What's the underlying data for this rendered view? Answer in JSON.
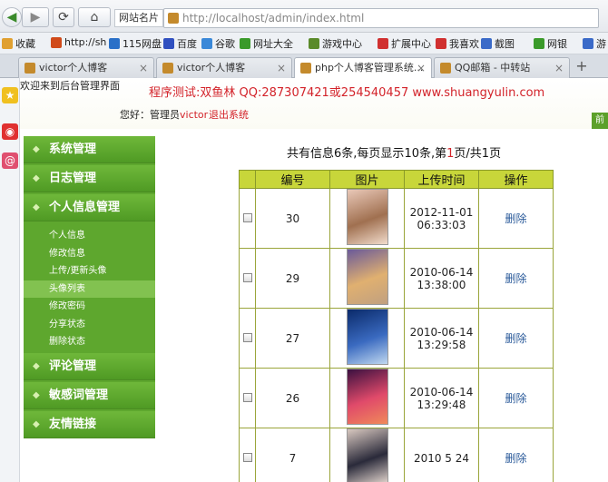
{
  "browser": {
    "site_name_label": "网站名片",
    "url": "http://localhost/admin/index.html",
    "bookmarks": [
      {
        "label": "收藏",
        "color": "#e0a030"
      },
      {
        "label": "http://sh",
        "color": "#d04a1a"
      },
      {
        "label": "115网盘",
        "color": "#2a70c8"
      },
      {
        "label": "百度",
        "color": "#3050c0"
      },
      {
        "label": "谷歌",
        "color": "#3a88d8"
      },
      {
        "label": "网址大全",
        "color": "#3a9a2a"
      },
      {
        "label": "游戏中心",
        "color": "#5a8a2a"
      },
      {
        "label": "扩展中心",
        "color": "#d03030"
      },
      {
        "label": "我喜欢",
        "color": "#d03030"
      },
      {
        "label": "截图",
        "color": "#3a6ac8"
      },
      {
        "label": "网银",
        "color": "#3a9a2a"
      },
      {
        "label": "游",
        "color": "#3a6ac8"
      }
    ],
    "tabs": [
      {
        "label": "victor个人博客",
        "active": false
      },
      {
        "label": "victor个人博客",
        "active": false
      },
      {
        "label": "php个人博客管理系统...",
        "active": true
      },
      {
        "label": "QQ邮箱 - 中转站",
        "active": false
      }
    ],
    "close_glyph": "×",
    "plus_glyph": "+"
  },
  "header": {
    "welcome": "欢迎来到后台管理界面",
    "promo": "程序测试:双鱼林 QQ:287307421或254540457 www.shuangyulin.com",
    "greet_prefix": "您好：管理员",
    "username": "victor",
    "logout": "退出系统",
    "right_badge": "前"
  },
  "sidebar": {
    "sections": [
      {
        "label": "系统管理"
      },
      {
        "label": "日志管理"
      },
      {
        "label": "个人信息管理"
      }
    ],
    "sub_items": [
      {
        "label": "个人信息",
        "active": false
      },
      {
        "label": "修改信息",
        "active": false
      },
      {
        "label": "上传/更新头像",
        "active": false
      },
      {
        "label": "头像列表",
        "active": true
      },
      {
        "label": "修改密码",
        "active": false
      },
      {
        "label": "分享状态",
        "active": false
      },
      {
        "label": "删除状态",
        "active": false
      }
    ],
    "sections_after": [
      {
        "label": "评论管理"
      },
      {
        "label": "敏感词管理"
      },
      {
        "label": "友情链接"
      }
    ]
  },
  "pager": {
    "p1": "共有信息",
    "total": "6",
    "p2": "条,每页显示",
    "per_page": "10",
    "p3": "条,第",
    "current": "1",
    "p4": "页/共",
    "pages": "1",
    "p5": "页"
  },
  "table": {
    "headers": [
      "编号",
      "图片",
      "上传时间",
      "操作"
    ],
    "rows": [
      {
        "id": "30",
        "time_line1": "2012-11-01",
        "time_line2": "06:33:03",
        "action": "删除",
        "img_colors": [
          "#e9c8b8",
          "#a07050",
          "#f2dccc"
        ]
      },
      {
        "id": "29",
        "time_line1": "2010-06-14",
        "time_line2": "13:38:00",
        "action": "删除",
        "img_colors": [
          "#6a5a9a",
          "#e0b070",
          "#c0a080"
        ]
      },
      {
        "id": "27",
        "time_line1": "2010-06-14",
        "time_line2": "13:29:58",
        "action": "删除",
        "img_colors": [
          "#0a2a6a",
          "#3a6ac0",
          "#c0d8f0"
        ]
      },
      {
        "id": "26",
        "time_line1": "2010-06-14",
        "time_line2": "13:29:48",
        "action": "删除",
        "img_colors": [
          "#3a1040",
          "#e04a6a",
          "#f08a5a"
        ]
      },
      {
        "id": "7",
        "time_line1": "2010 5 24",
        "time_line2": "",
        "action": "删除",
        "img_colors": [
          "#d8c8c0",
          "#2a2a3a",
          "#e6d8d0"
        ]
      }
    ]
  }
}
